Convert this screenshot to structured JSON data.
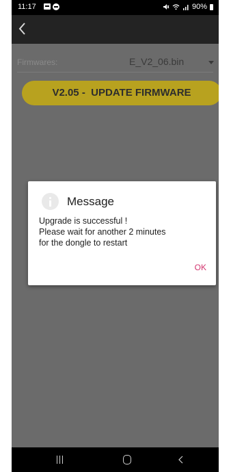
{
  "status_bar": {
    "time": "11:17",
    "battery": "90%"
  },
  "screen": {
    "firmwares_label": "Firmwares:",
    "selected_firmware": "E_V2_06.bin",
    "update_button_label": "V2.05 -  UPDATE FIRMWARE"
  },
  "dialog": {
    "title": "Message",
    "message_lines": [
      "Upgrade is successful !",
      "Please wait for another 2 minutes",
      "for the dongle to restart"
    ],
    "ok_label": "OK"
  },
  "colors": {
    "update_button": "#b8a21f",
    "dialog_ok": "#d2346e",
    "overlay": "#6b6b6b"
  },
  "icons": {
    "back": "arrow-back-icon",
    "dropdown": "caret-down-icon",
    "dialog": "info-icon",
    "nav_recents": "recents-icon",
    "nav_home": "home-icon",
    "nav_back": "nav-back-icon"
  }
}
